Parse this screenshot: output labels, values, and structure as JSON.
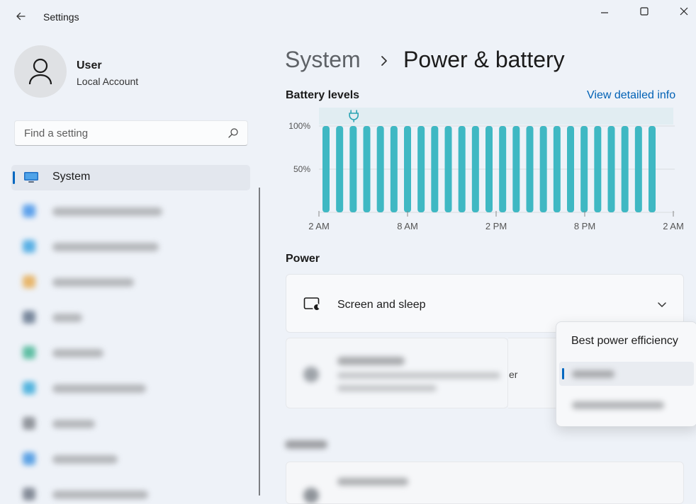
{
  "window": {
    "title": "Settings",
    "controls": {
      "minimize": "minimize-icon",
      "maximize": "maximize-icon",
      "close": "close-icon"
    }
  },
  "user": {
    "name": "User",
    "account_type": "Local Account"
  },
  "search": {
    "placeholder": "Find a setting"
  },
  "sidebar": {
    "selected_item": "System",
    "blurred_items": [
      {
        "icon_color": "#3b8ee8"
      },
      {
        "icon_color": "#35a0e0"
      },
      {
        "icon_color": "#e6a84a"
      },
      {
        "icon_color": "#5c6e86"
      },
      {
        "icon_color": "#3db28f"
      },
      {
        "icon_color": "#2fa6d8"
      },
      {
        "icon_color": "#7b7f86"
      },
      {
        "icon_color": "#3a8fe0"
      },
      {
        "icon_color": "#6a7280"
      }
    ]
  },
  "breadcrumb": {
    "parent": "System",
    "current": "Power & battery"
  },
  "battery_levels": {
    "title": "Battery levels",
    "link": "View detailed info"
  },
  "chart_data": {
    "type": "bar",
    "y_ticks": [
      "100%",
      "50%"
    ],
    "x_ticks": [
      "2 AM",
      "8 AM",
      "2 PM",
      "8 PM",
      "2 AM"
    ],
    "values": [
      100,
      100,
      100,
      100,
      100,
      100,
      100,
      100,
      100,
      100,
      100,
      100,
      100,
      100,
      100,
      100,
      100,
      100,
      100,
      100,
      100,
      100,
      100,
      100,
      100
    ],
    "charging_marker_at_bar": 1,
    "ylim": [
      0,
      100
    ],
    "bar_color": "#3fb8c3"
  },
  "power": {
    "title": "Power",
    "screen_sleep_label": "Screen and sleep",
    "power_mode_suffix": "er"
  },
  "power_mode_dropdown": {
    "options": [
      "Best power efficiency"
    ]
  }
}
